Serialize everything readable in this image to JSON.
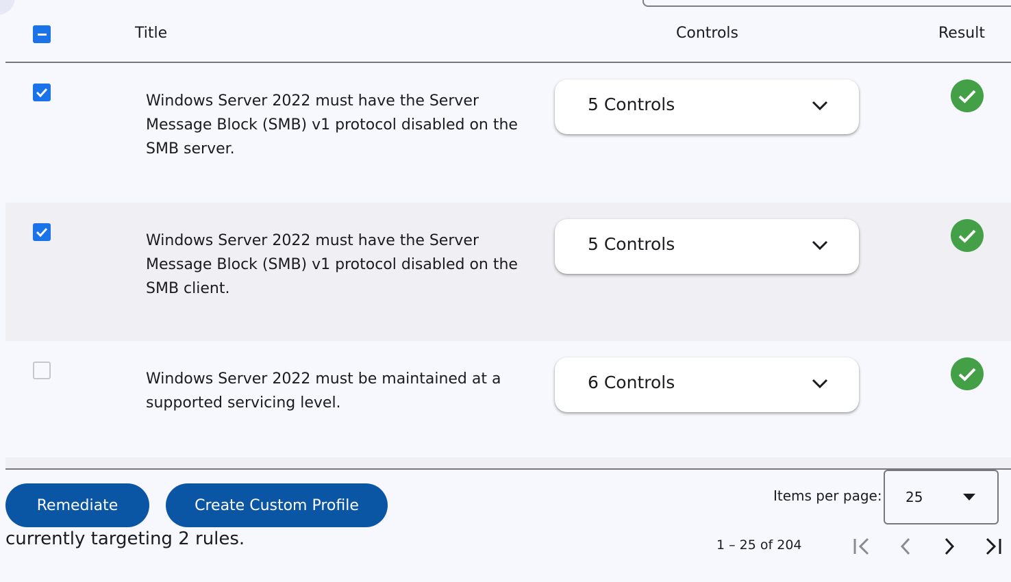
{
  "table": {
    "headers": {
      "title": "Title",
      "controls": "Controls",
      "result": "Result"
    },
    "select_all_state": "indeterminate",
    "rows": [
      {
        "title": "Windows Server 2022 must have the Server Message Block (SMB) v1 protocol disabled on the SMB server.",
        "checked": true,
        "controls_label": "5 Controls",
        "result": "pass"
      },
      {
        "title": "Windows Server 2022 must have the Server Message Block (SMB) v1 protocol disabled on the SMB client.",
        "checked": true,
        "controls_label": "5 Controls",
        "result": "pass"
      },
      {
        "title": "Windows Server 2022 must be maintained at a supported servicing level.",
        "checked": false,
        "controls_label": "6 Controls",
        "result": "pass"
      }
    ]
  },
  "actions": {
    "remediate_label": "Remediate",
    "create_profile_label": "Create Custom Profile"
  },
  "status_text": "currently targeting 2 rules.",
  "paginator": {
    "items_per_page_label": "Items per page:",
    "items_per_page_value": "25",
    "range_label": "1 – 25 of 204"
  },
  "colors": {
    "primary_button": "#0b56a4",
    "checkbox_checked": "#1a73e8",
    "result_pass": "#43a047",
    "alt_row": "#efeff4"
  },
  "icons": {
    "result_pass": "check-circle-icon",
    "controls_toggle": "chevron-down-icon",
    "first_page": "first-page-icon",
    "previous_page": "chevron-left-icon",
    "next_page": "chevron-right-icon",
    "last_page": "last-page-icon"
  }
}
